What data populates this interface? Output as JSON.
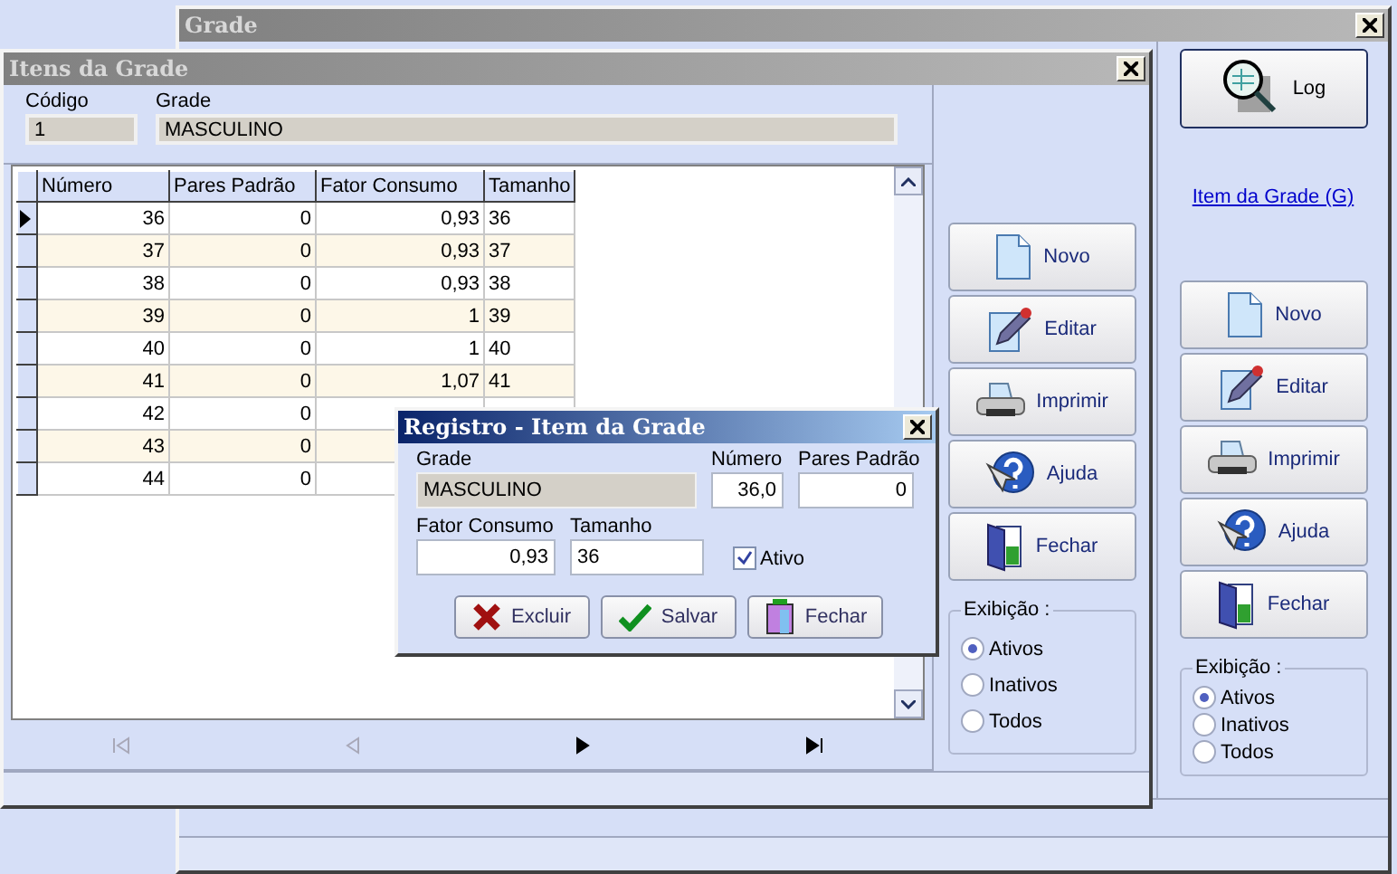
{
  "main_window": {
    "title": "Grade",
    "log_button": "Log",
    "link": "Item da Grade (G)",
    "actions": [
      {
        "kind": "new",
        "label": "Novo"
      },
      {
        "kind": "edit",
        "label": "Editar"
      },
      {
        "kind": "print",
        "label": "Imprimir"
      },
      {
        "kind": "help",
        "label": "Ajuda"
      },
      {
        "kind": "close",
        "label": "Fechar"
      }
    ],
    "display_filter": {
      "legend": "Exibição :",
      "options": [
        {
          "label": "Ativos",
          "selected": true
        },
        {
          "label": "Inativos",
          "selected": false
        },
        {
          "label": "Todos",
          "selected": false
        }
      ]
    }
  },
  "items_window": {
    "title": "Itens da Grade",
    "code_label": "Código",
    "code_value": "1",
    "grade_label": "Grade",
    "grade_value": "MASCULINO",
    "table": {
      "columns": [
        "Número",
        "Pares Padrão",
        "Fator Consumo",
        "Tamanho"
      ],
      "rows": [
        {
          "selected": true,
          "cells": [
            "36",
            "0",
            "0,93",
            "36"
          ]
        },
        {
          "selected": false,
          "cells": [
            "37",
            "0",
            "0,93",
            "37"
          ]
        },
        {
          "selected": false,
          "cells": [
            "38",
            "0",
            "0,93",
            "38"
          ]
        },
        {
          "selected": false,
          "cells": [
            "39",
            "0",
            "1",
            "39"
          ]
        },
        {
          "selected": false,
          "cells": [
            "40",
            "0",
            "1",
            "40"
          ]
        },
        {
          "selected": false,
          "cells": [
            "41",
            "0",
            "1,07",
            "41"
          ]
        },
        {
          "selected": false,
          "cells": [
            "42",
            "0",
            null,
            null
          ]
        },
        {
          "selected": false,
          "cells": [
            "43",
            "0",
            null,
            null
          ]
        },
        {
          "selected": false,
          "cells": [
            "44",
            "0",
            null,
            null
          ]
        }
      ]
    },
    "navigator": [
      {
        "kind": "first",
        "disabled": true
      },
      {
        "kind": "prev",
        "disabled": true
      },
      {
        "kind": "next",
        "disabled": false
      },
      {
        "kind": "last",
        "disabled": false
      }
    ],
    "actions": [
      {
        "kind": "new",
        "label": "Novo"
      },
      {
        "kind": "edit",
        "label": "Editar"
      },
      {
        "kind": "print",
        "label": "Imprimir"
      },
      {
        "kind": "help",
        "label": "Ajuda"
      },
      {
        "kind": "close",
        "label": "Fechar"
      }
    ],
    "display_filter": {
      "legend": "Exibição :",
      "options": [
        {
          "label": "Ativos",
          "selected": true
        },
        {
          "label": "Inativos",
          "selected": false
        },
        {
          "label": "Todos",
          "selected": false
        }
      ]
    }
  },
  "dialog": {
    "title": "Registro - Item da Grade",
    "fields": [
      {
        "label": "Grade",
        "value": "MASCULINO",
        "kind": "readonly"
      },
      {
        "label": "Número",
        "value": "36,0",
        "kind": "number"
      },
      {
        "label": "Pares Padrão",
        "value": "0",
        "kind": "number"
      },
      {
        "label": "Fator Consumo",
        "value": "0,93",
        "kind": "number"
      },
      {
        "label": "Tamanho",
        "value": "36",
        "kind": "text"
      }
    ],
    "active": {
      "label": "Ativo",
      "checked": true
    },
    "buttons": [
      {
        "kind": "delete",
        "label": "Excluir"
      },
      {
        "kind": "save",
        "label": "Salvar"
      },
      {
        "kind": "close",
        "label": "Fechar"
      }
    ]
  }
}
